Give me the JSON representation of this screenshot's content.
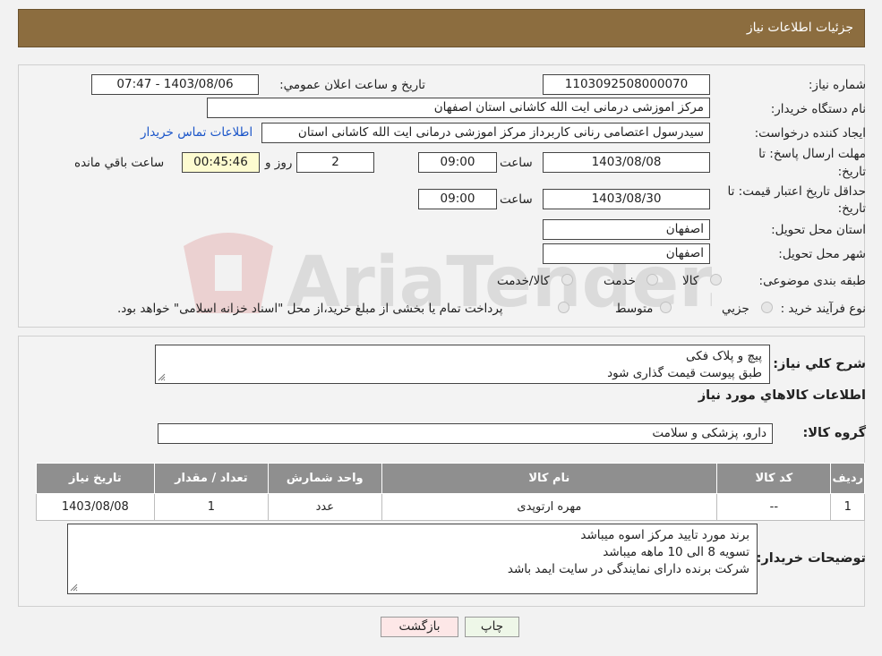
{
  "header": {
    "title": "جزئیات اطلاعات نیاز"
  },
  "fields": {
    "need_number_label": "شماره نیاز:",
    "need_number": "1103092508000070",
    "announce_label": "تاریخ و ساعت اعلان عمومي:",
    "announce_value": "1403/08/06 - 07:47",
    "buyer_org_label": "نام دستگاه خريدار:",
    "buyer_org": "مرکز اموزشی درمانی ایت الله کاشانی استان اصفهان",
    "creator_label": "ايجاد کننده درخواست:",
    "creator": "سیدرسول اعتصامی رنانی کاربرداز مرکز اموزشی درمانی ایت الله کاشانی استان",
    "contact_link": "اطلاعات تماس خريدار",
    "reply_deadline_label_1": "مهلت ارسال پاسخ: تا",
    "reply_deadline_label_2": "تاريخ:",
    "reply_date": "1403/08/08",
    "time_label": "ساعت",
    "reply_time": "09:00",
    "days_value": "2",
    "days_label": "روز و",
    "remaining_value": "00:45:46",
    "remaining_label": "ساعت باقي مانده",
    "price_valid_label_1": "حداقل تاريخ اعتبار قيمت: تا",
    "price_valid_label_2": "تاريخ:",
    "price_date": "1403/08/30",
    "price_time": "09:00",
    "province_label": "استان محل تحويل:",
    "province": "اصفهان",
    "city_label": "شهر محل تحويل:",
    "city": "اصفهان",
    "category_label": "طبقه بندی موضوعی:",
    "category_options": [
      "کالا",
      "خدمت",
      "کالا/خدمت"
    ],
    "process_label": "نوع فرآيند خريد :",
    "process_options": [
      "جزيي",
      "متوسط"
    ],
    "process_note": "پرداخت تمام يا بخشی از مبلغ خريد،از محل \"اسناد خزانه اسلامی\" خواهد بود."
  },
  "description": {
    "label": "شرح كلي نياز:",
    "lines": [
      "پيچ و پلاک فکی",
      "طبق پیوست قیمت گذاری شود"
    ]
  },
  "goods_section_title": "اطلاعات كالاهاي مورد نياز",
  "goods_group": {
    "label": "گروه كالا:",
    "value": "دارو، پزشکی و سلامت"
  },
  "table": {
    "headers": [
      "رديف",
      "كد كالا",
      "نام كالا",
      "واحد شمارش",
      "تعداد / مقدار",
      "تاريخ نياز"
    ],
    "rows": [
      [
        "1",
        "--",
        "مهره ارتوپدی",
        "عدد",
        "1",
        "1403/08/08"
      ]
    ]
  },
  "buyer_notes": {
    "label": "توضيحات خريدار:",
    "lines": [
      "برند مورد تایید مرکز اسوه میباشد",
      "تسویه 8 الی 10 ماهه میباشد",
      "شرکت برنده دارای نمایندگی در سایت ایمد باشد"
    ]
  },
  "buttons": {
    "print": "چاپ",
    "back": "بازگشت"
  },
  "watermark": {
    "text": "AriaTender.neT"
  },
  "colors": {
    "header": "#8c6d3f",
    "table_header": "#8f8f8f",
    "link": "#1a55c9",
    "back_button": "#fde7e7",
    "print_button": "#eef7e8"
  }
}
